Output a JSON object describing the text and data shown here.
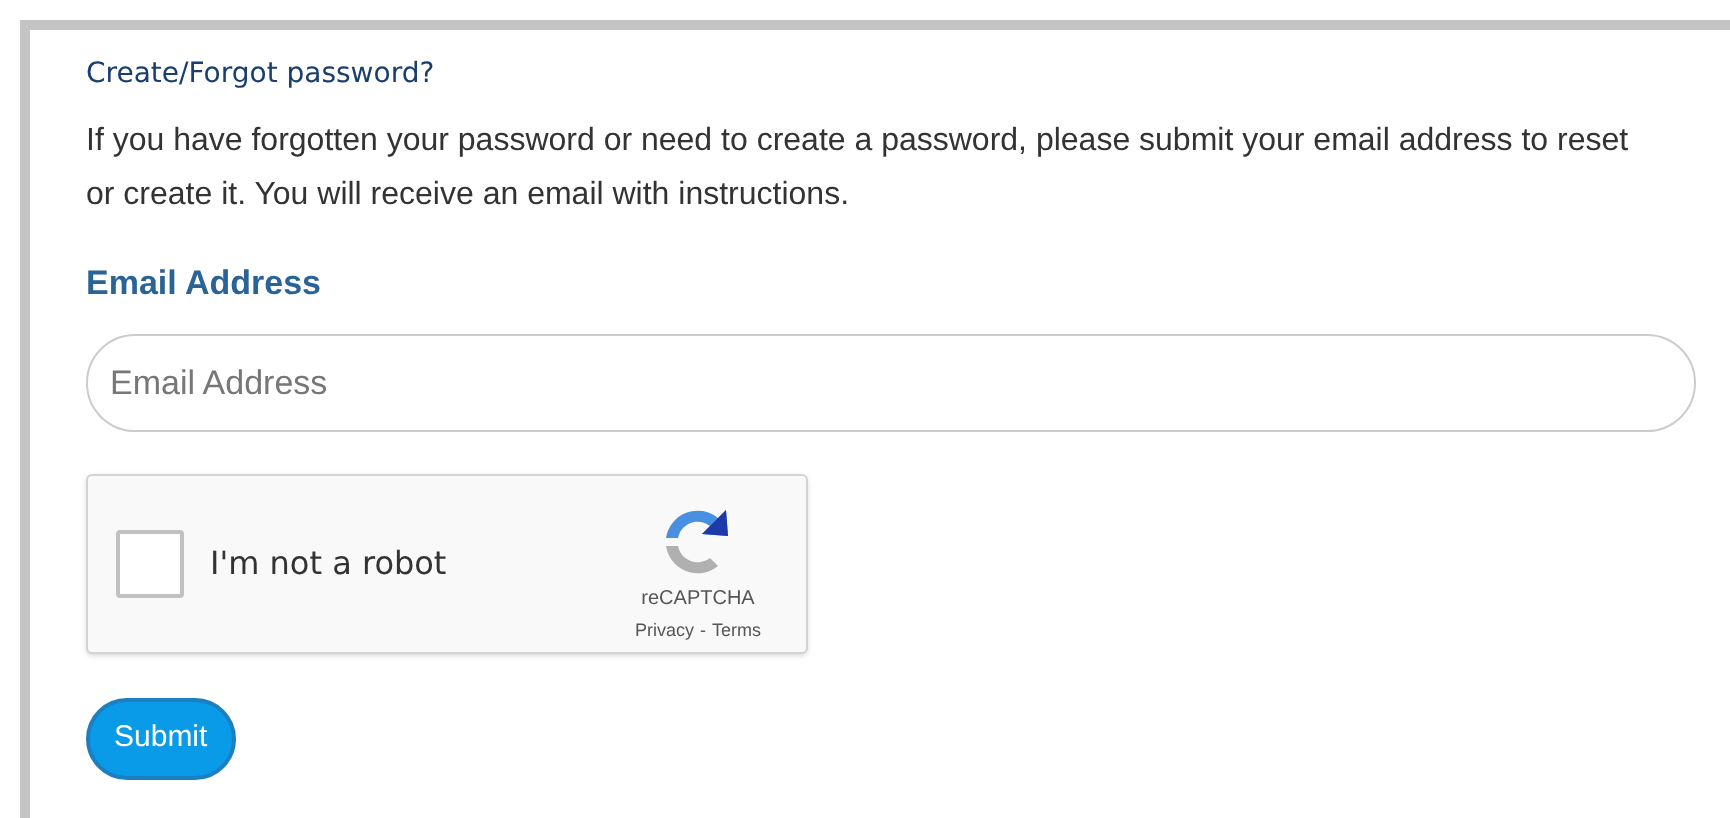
{
  "heading": "Create/Forgot password?",
  "intro": "If you have forgotten your password or need to create a password, please submit your email address to reset or create it. You will receive an email with instructions.",
  "email_field": {
    "label": "Email Address",
    "placeholder": "Email Address"
  },
  "captcha": {
    "label": "I'm not a robot",
    "checked": false,
    "brand": "reCAPTCHA",
    "links": [
      "Privacy",
      "Terms"
    ],
    "separator": "-"
  },
  "submit_button": "Submit"
}
